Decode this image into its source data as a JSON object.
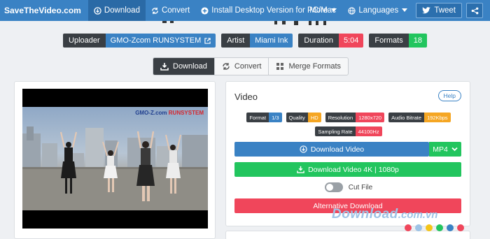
{
  "nav": {
    "brand": "SaveTheVideo.com",
    "download": "Download",
    "convert": "Convert",
    "install": "Install Desktop Version for PC/Mac",
    "more": "More",
    "languages": "Languages",
    "tweet": "Tweet"
  },
  "meta": {
    "uploader_label": "Uploader",
    "uploader_value": "GMO-Zcom RUNSYSTEM",
    "artist_label": "Artist",
    "artist_value": "Miami Ink",
    "duration_label": "Duration",
    "duration_value": "5:04",
    "formats_label": "Formats",
    "formats_value": "18"
  },
  "tabs": {
    "download": "Download",
    "convert": "Convert",
    "merge": "Merge Formats"
  },
  "video": {
    "watermark_blue": "GMO-Z.com",
    "watermark_red": "RUNSYSTEM"
  },
  "panel": {
    "heading": "Video",
    "help": "Help",
    "format_label": "Format",
    "format_value": "1/3",
    "quality_label": "Quality",
    "quality_value": "HD",
    "resolution_label": "Resolution",
    "resolution_value": "1280x720",
    "bitrate_label": "Audio Bitrate",
    "bitrate_value": "192Kbps",
    "sampling_label": "Sampling Rate",
    "sampling_value": "44100Hz",
    "download_video": "Download Video",
    "format_select": "MP4",
    "download_4k": "Download Video 4K | 1080p",
    "cut_file": "Cut File",
    "alt_download": "Alternative Download"
  },
  "watermark": {
    "main": "Download",
    "suffix": ".com.vn"
  },
  "colors": {
    "primary": "#3a82c4",
    "dark": "#3a3f44",
    "red": "#f0465b",
    "green": "#22c55e",
    "orange": "#f5a623"
  },
  "dots": [
    "#f0465b",
    "#9ec3e6",
    "#f5c518",
    "#22c55e",
    "#3a82c4",
    "#f0465b"
  ]
}
